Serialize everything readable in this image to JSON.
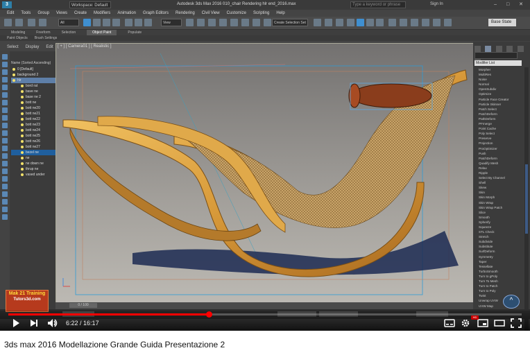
{
  "app": {
    "logo": "3",
    "workspace": "Workspace: Default",
    "window_title": "Autodesk 3ds Max 2016    010_chair Rendering hlr end_2016.max",
    "search_placeholder": "Type a keyword or phrase",
    "sign_in": "Sign In",
    "window_buttons": "–  □  ✕"
  },
  "menu": [
    "Edit",
    "Tools",
    "Group",
    "Views",
    "Create",
    "Modifiers",
    "Animation",
    "Graph Editors",
    "Rendering",
    "Civil View",
    "Customize",
    "Scripting",
    "Help"
  ],
  "toolbar": {
    "filter_value": "All",
    "view_value": "View",
    "selection_set": "Create Selection Set",
    "base_state": "Base State"
  },
  "ribbon": {
    "tabs": [
      "Modeling",
      "Freeform",
      "Selection",
      "Object Paint",
      "Populate"
    ],
    "active_index": 3,
    "sub": [
      "Paint Objects",
      "Brush Settings"
    ]
  },
  "scene_explorer": {
    "menu": [
      "Select",
      "Display",
      "Edit"
    ],
    "header": "Name (Sorted Ascending)",
    "rows": [
      "0 [Default]",
      "background 2",
      "hlr",
      "bord rat",
      "bave ne",
      "base ne 2",
      "bott ne",
      "bott ne20",
      "bott ne21",
      "bott ne22",
      "bott ne23",
      "bott ne24",
      "bott ne25",
      "bott ne26",
      "bott ne27",
      "bezel ne",
      "ne",
      "ne down ne",
      "thrup ne",
      "vased under"
    ],
    "highlight_row": 2,
    "selected_row": 15
  },
  "viewport": {
    "label": "[ + ] [ Camera01 ] [ Realistic ]"
  },
  "command_panel": {
    "name_field": "",
    "modifier_list": "Modifier List",
    "items": [
      "Morpher",
      "MultiRes",
      "Noise",
      "Normal",
      "OpenSubdiv",
      "Optimize",
      "Particle Face Creator",
      "Particle Skinner",
      "Patch Select",
      "PatchDeform",
      "PathDeform",
      "PFmerge",
      "Point Cache",
      "Poly Select",
      "Preserve",
      "Projection",
      "ProOptimizer",
      "Push",
      "PatchDeform",
      "Quadify Mesh",
      "Relax",
      "Ripple",
      "Select By Channel",
      "Shell",
      "Skew",
      "Skin",
      "Skin Morph",
      "Skin Wrap",
      "Skin Wrap Patch",
      "Slice",
      "Smooth",
      "Spherify",
      "Squeeze",
      "STL Check",
      "Stretch",
      "Subdivide",
      "Substitute",
      "SurfDeform",
      "Symmetry",
      "Taper",
      "Tessellate",
      "TurboSmooth",
      "Turn to gPoly",
      "Turn To Mesh",
      "Turn to Patch",
      "Turn to Poly",
      "Twist",
      "Unwrap UVW",
      "UVW Map"
    ]
  },
  "timeline": {
    "counter": "0 / 100"
  },
  "watermark": {
    "line1": "Mak 21 Training",
    "line2": "Tutors3d.com"
  },
  "video": {
    "current_time": "6:22",
    "total_time": "16:17",
    "time_separator": " / ",
    "progress": 0.391,
    "settings_badge": "HD",
    "title": "3ds max 2016 Modellazione Grande Guida Presentazione 2"
  },
  "colors": {
    "progress": "#ff0000",
    "accent": "#3f8fd0",
    "wood": "#d89a3a"
  }
}
